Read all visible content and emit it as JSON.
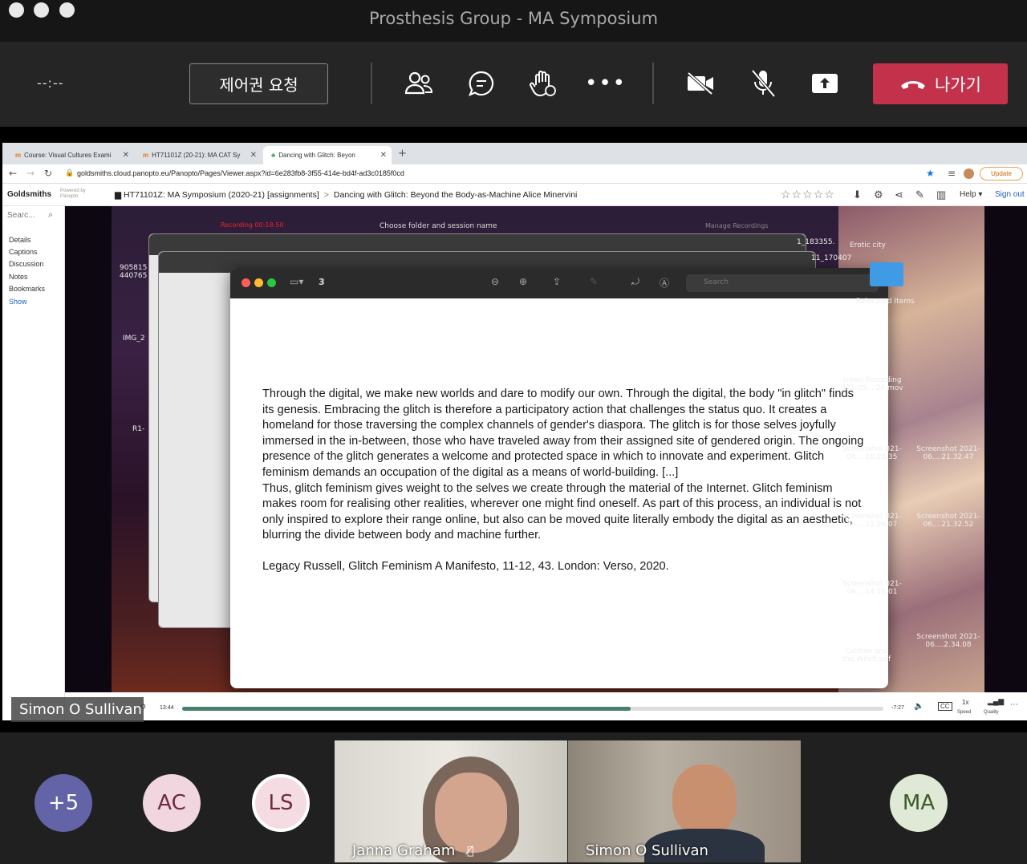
{
  "window": {
    "title": "Prosthesis Group - MA Symposium"
  },
  "toolbar": {
    "timer": "--:--",
    "request_control_label": "제어권 요청",
    "leave_label": "나가기",
    "icons": [
      "participants-icon",
      "chat-icon",
      "raise-hand-icon",
      "more-icon",
      "camera-off-icon",
      "mic-off-icon",
      "share-icon",
      "phone-hangup-icon"
    ]
  },
  "browser": {
    "tabs": [
      {
        "label": "Course: Visual Cultures Exami"
      },
      {
        "label": "HT71101Z (20-21): MA CAT Sy"
      },
      {
        "label": "Dancing with Glitch: Beyon"
      }
    ],
    "url": "goldsmiths.cloud.panopto.eu/Panopto/Pages/Viewer.aspx?id=6e283fb8-3f55-414e-bd4f-ad3c0185f0cd",
    "update_label": "Update"
  },
  "panopto": {
    "logo": "Goldsmiths",
    "powered_by": "Powered by Panopto",
    "breadcrumb_folder": "HT71101Z: MA Symposium (2020-21) [assignments]",
    "breadcrumb_session": "Dancing with Glitch: Beyond the Body-as-Machine Alice Minervini",
    "stars": "☆☆☆☆☆",
    "help_label": "Help ▾",
    "sign_out_label": "Sign out",
    "search_placeholder": "Searc...",
    "side_links": [
      "Details",
      "Captions",
      "Discussion",
      "Notes",
      "Bookmarks",
      "Show"
    ]
  },
  "video": {
    "recording_label": "Recording 00:18:50",
    "dialog_title": "Choose folder and session name",
    "manage_label": "Manage Recordings",
    "page_number": "3",
    "search_placeholder": "Search",
    "quote_p1": "Through the digital, we make new worlds and dare to modify our own. Through the digital, the body \"in glitch\" finds its genesis. Embracing the glitch is therefore a participatory action that challenges the status quo. It creates a homeland for those traversing the complex channels of gender's diaspora. The glitch is for those selves joyfully immersed in the in-between, those who have traveled away from their assigned site of gendered origin. The ongoing presence of the glitch generates a welcome and protected space in which to innovate and experiment. Glitch feminism demands an occupation of the digital as a means of world-building. [...]",
    "quote_p2": "Thus, glitch feminism gives weight to the selves we create through the material of the Internet. Glitch feminism makes room for realising other realities, wherever one might find oneself. As part of this process, an individual is not only inspired to explore their range online, but also can be moved quite literally embody the digital as an aesthetic, blurring the divide between body and machine further.",
    "citation": "Legacy Russell, Glitch Feminism A Manifesto, 11-12, 43. London: Verso, 2020.",
    "desktop_items": [
      "Erotic city",
      "Relocated Items",
      "creen Recording 021-05....24.mov",
      "Screenshot 021-06....10.28.35",
      "Screenshot 2021-06....21.32.47",
      "Screenshot 021-06....11.26.07",
      "Screenshot 2021-06....21.32.52",
      "Screenshot 021-06....14.16.01",
      "Screenshot 2021-06....2.34.08",
      "Caliban and the Witch.pdf",
      "1_183355.",
      "11_170407",
      "905815 440765",
      "IMG_2",
      "R1-"
    ]
  },
  "player": {
    "elapsed": "13:44",
    "remaining": "-7:27",
    "progress": 0.64,
    "speed_value": "1x",
    "speed_label": "Speed",
    "quality_label": "Quality"
  },
  "speaker": {
    "name": "Simon O Sullivan"
  },
  "gallery": {
    "overflow": "+5",
    "avatars": [
      {
        "initials": "AC",
        "bg": "#f1d6df",
        "fg": "#6b2b44"
      },
      {
        "initials": "LS",
        "bg": "#f4dce2",
        "fg": "#6b2b44"
      },
      {
        "initials": "MA",
        "bg": "#dfe9d5",
        "fg": "#3f5a2a"
      }
    ],
    "overflow_bg": "#6264a7",
    "tiles": [
      {
        "name": "Janna Graham"
      },
      {
        "name": "Simon O Sullivan"
      }
    ]
  }
}
